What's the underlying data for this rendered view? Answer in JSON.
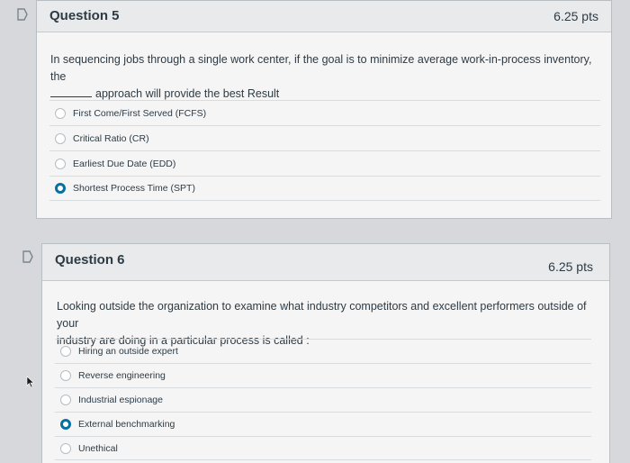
{
  "question5": {
    "title": "Question 5",
    "points": "6.25 pts",
    "text_line1": "In sequencing jobs through a single work center, if the goal is to minimize average work-in-process inventory, the",
    "text_line2": "approach will provide the best Result",
    "answers": [
      {
        "label": "First Come/First Served (FCFS)",
        "selected": false
      },
      {
        "label": "Critical Ratio (CR)",
        "selected": false
      },
      {
        "label": "Earliest Due Date (EDD)",
        "selected": false
      },
      {
        "label": "Shortest Process Time (SPT)",
        "selected": true
      }
    ]
  },
  "question6": {
    "title": "Question 6",
    "points": "6.25 pts",
    "text_line1": "Looking outside the organization to examine what industry competitors and excellent performers outside of your",
    "text_line2": "industry are doing in a particular process is called :",
    "answers": [
      {
        "label": "Hiring an outside expert",
        "selected": false
      },
      {
        "label": "Reverse engineering",
        "selected": false
      },
      {
        "label": "Industrial espionage",
        "selected": false
      },
      {
        "label": "External benchmarking",
        "selected": true
      },
      {
        "label": "Unethical",
        "selected": false
      }
    ]
  },
  "colors": {
    "accent": "#0770a3",
    "text": "#2d3b45",
    "header_bg": "#e8eaec",
    "card_bg": "#f5f5f5"
  },
  "icons": {
    "flag": "bookmark-flag-icon",
    "cursor": "mouse-pointer-icon"
  }
}
